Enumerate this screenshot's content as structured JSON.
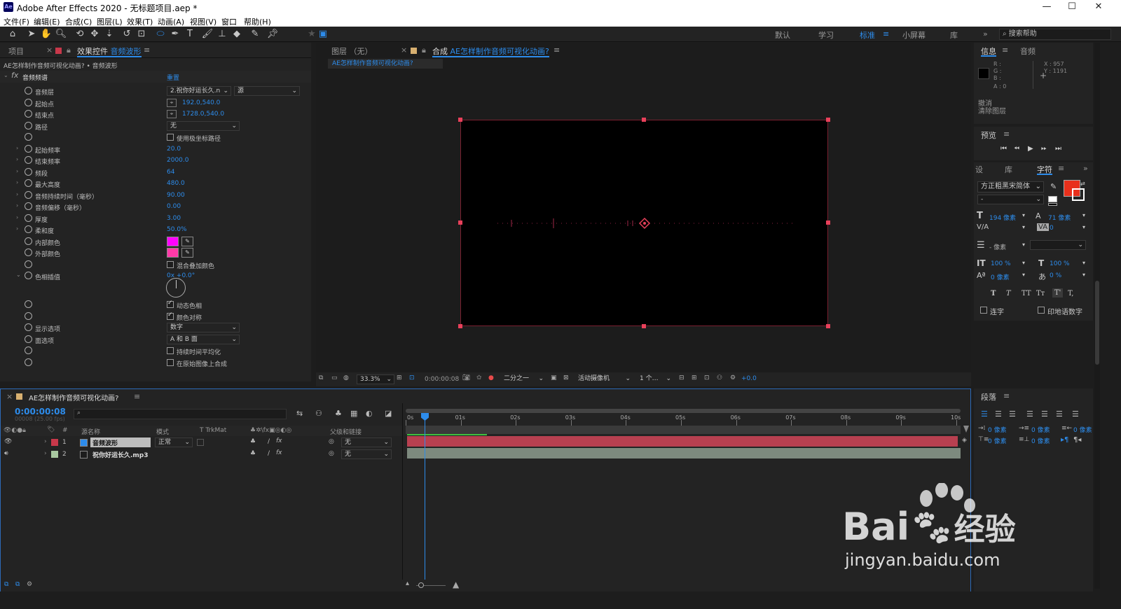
{
  "app": {
    "title": "Adobe After Effects 2020 - 无标题项目.aep *",
    "logo": "Ae"
  },
  "menu": [
    "文件(F)",
    "编辑(E)",
    "合成(C)",
    "图层(L)",
    "效果(T)",
    "动画(A)",
    "视图(V)",
    "窗口",
    "帮助(H)"
  ],
  "workspaces": {
    "default": "默认",
    "learn": "学习",
    "standard": "标准",
    "small": "小屏幕",
    "library": "库",
    "search": "搜索帮助"
  },
  "left_panel": {
    "tab_project": "项目",
    "tab_effects_prefix": "效果控件",
    "tab_effects_layer": "音频波形",
    "breadcrumb": "AE怎样制作音频可视化动画? • 音频波形",
    "effect_name": "音频频谱",
    "reset": "重置"
  },
  "props": [
    {
      "name": "音频层",
      "value": "2.祝你好运长久.n",
      "extra": "源",
      "type": "dd2"
    },
    {
      "name": "起始点",
      "value": "192.0,540.0",
      "type": "point"
    },
    {
      "name": "结束点",
      "value": "1728.0,540.0",
      "type": "point"
    },
    {
      "name": "路径",
      "value": "无",
      "type": "dd"
    },
    {
      "name": "",
      "value": "使用极坐标路径",
      "type": "cb",
      "on": false
    },
    {
      "name": "起始频率",
      "value": "20.0",
      "type": "num",
      "tw": true
    },
    {
      "name": "结束频率",
      "value": "2000.0",
      "type": "num",
      "tw": true
    },
    {
      "name": "频段",
      "value": "64",
      "type": "num",
      "tw": true
    },
    {
      "name": "最大高度",
      "value": "480.0",
      "type": "num",
      "tw": true
    },
    {
      "name": "音频持续时间（毫秒）",
      "value": "90.00",
      "type": "num",
      "tw": true
    },
    {
      "name": "音频偏移（毫秒）",
      "value": "0.00",
      "type": "num",
      "tw": true
    },
    {
      "name": "厚度",
      "value": "3.00",
      "type": "num",
      "tw": true
    },
    {
      "name": "柔和度",
      "value": "50.0%",
      "type": "num",
      "tw": true
    },
    {
      "name": "内部颜色",
      "value": "#ff00ff",
      "type": "color"
    },
    {
      "name": "外部颜色",
      "value": "#ff3aa8",
      "type": "color"
    },
    {
      "name": "",
      "value": "混合叠加颜色",
      "type": "cb",
      "on": false
    },
    {
      "name": "色相插值",
      "value": "0x +0.0°",
      "type": "num",
      "tw": true,
      "open": true
    }
  ],
  "props2": [
    {
      "name": "",
      "value": "动态色相",
      "type": "cb",
      "on": true
    },
    {
      "name": "",
      "value": "颜色对称",
      "type": "cb",
      "on": true
    },
    {
      "name": "显示选项",
      "value": "数字",
      "type": "dd"
    },
    {
      "name": "面选项",
      "value": "A 和 B 面",
      "type": "dd"
    },
    {
      "name": "",
      "value": "持续时间平均化",
      "type": "cb",
      "on": false
    },
    {
      "name": "",
      "value": "在原始图像上合成",
      "type": "cb",
      "on": false
    }
  ],
  "viewer": {
    "tab_layer": "图层 （无）",
    "tab_comp_prefix": "合成",
    "tab_comp_name": "AE怎样制作音频可视化动画?",
    "crumb": "AE怎样制作音频可视化动画?",
    "zoom": "33.3%",
    "timecode": "0:00:00:08",
    "resolution": "二分之一",
    "camera": "活动摄像机",
    "views": "1 个…",
    "exposure": "+0.0"
  },
  "info": {
    "tab_info": "信息",
    "tab_audio": "音频",
    "r": "R :",
    "g": "G :",
    "b": "B :",
    "a": "A : 0",
    "x": "X : 957",
    "y": "Y : 1191",
    "undo": "撤消",
    "undo2": "清除图层"
  },
  "preview": {
    "title": "预览"
  },
  "char_panel": {
    "tab_set": "设",
    "tab_lib": "库",
    "tab_char": "字符",
    "font": "方正粗黑宋简体",
    "style": "-",
    "size": "194 像素",
    "leading": "71 像素",
    "kerning": "",
    "tracking": "0",
    "stroke": "- 像素",
    "vscale": "100 %",
    "hscale": "100 %",
    "baseline": "0 像素",
    "tsume": "0 %",
    "ligature": "连字",
    "hindi": "印地语数字",
    "fill_color": "#e8301c"
  },
  "para_panel": {
    "title": "段落",
    "indent1": "0 像素",
    "indent2": "0 像素",
    "indent3": "0 像素",
    "space1": "0 像素",
    "space2": "0 像素"
  },
  "timeline": {
    "comp": "AE怎样制作音频可视化动画?",
    "timecode": "0:00:00:08",
    "fps": "00008 (25.00 fps)",
    "col_name": "源名称",
    "col_mode": "模式",
    "col_trkmat": "T  TrkMat",
    "col_parent": "父级和链接",
    "ticks": [
      "0s",
      "01s",
      "02s",
      "03s",
      "04s",
      "05s",
      "06s",
      "07s",
      "08s",
      "09s",
      "10s"
    ],
    "layers": [
      {
        "num": "1",
        "name": "音频波形",
        "mode": "正常",
        "parent": "无",
        "color": "#c8384a"
      },
      {
        "num": "2",
        "name": "祝你好运长久.mp3",
        "mode": "",
        "parent": "无",
        "color": "#a8c8a0"
      }
    ]
  },
  "watermark": {
    "brand": "Bai",
    "brand2": "经验",
    "url": "jingyan.baidu.com"
  }
}
